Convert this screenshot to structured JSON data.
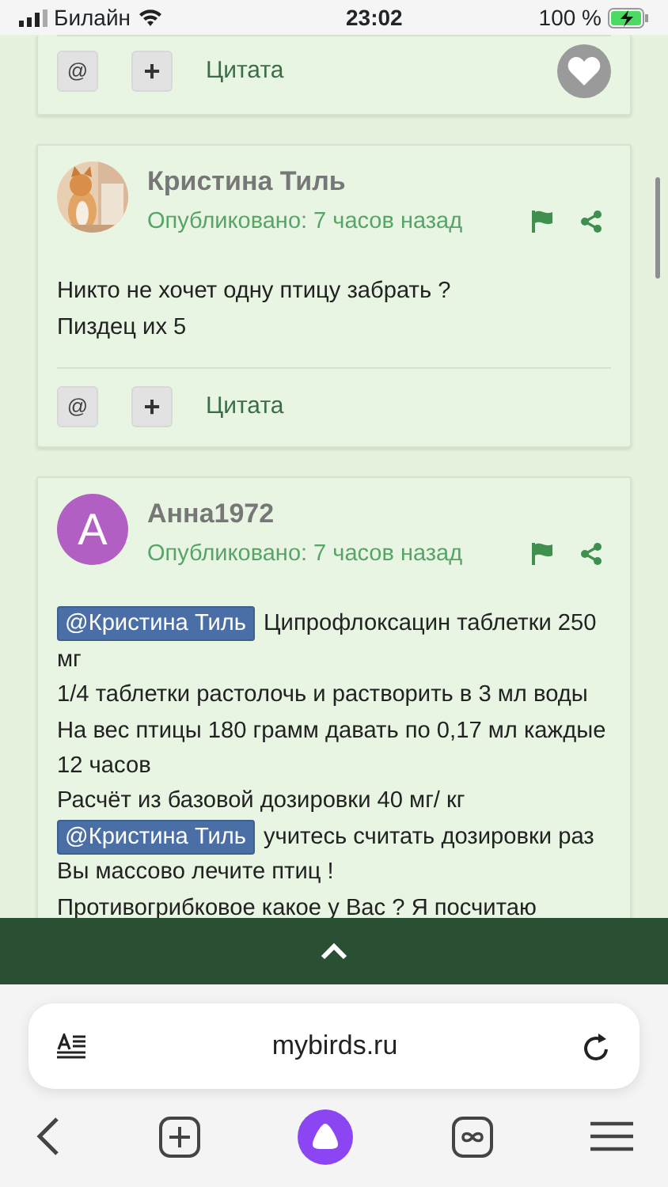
{
  "status_bar": {
    "carrier": "Билайн",
    "time": "23:02",
    "battery": "100 %"
  },
  "posts": [
    {
      "kind": "footer_only",
      "actions": {
        "mention": "@",
        "add": "+",
        "quote": "Цитата"
      },
      "like": true
    },
    {
      "kind": "full",
      "author": "Кристина Тиль",
      "published": "Опубликовано: 7 часов назад",
      "avatar": {
        "kind": "picture"
      },
      "body": [
        [
          {
            "kind": "text",
            "text": "Никто не хочет одну птицу забрать ?"
          }
        ],
        [
          {
            "kind": "text",
            "text": "Пиздец их 5"
          }
        ]
      ],
      "actions": {
        "mention": "@",
        "add": "+",
        "quote": "Цитата"
      }
    },
    {
      "kind": "full",
      "author": "Анна1972",
      "published": "Опубликовано: 7 часов назад",
      "avatar": {
        "kind": "letter",
        "letter": "A",
        "color": "#b25fc4"
      },
      "body": [
        [
          {
            "kind": "mention",
            "text": "@Кристина Тиль"
          },
          {
            "kind": "text",
            "text": "Ципрофлоксацин  таблетки 250 мг"
          }
        ],
        [
          {
            "kind": "text",
            "text": "1/4 таблетки растолочь и растворить в 3 мл воды"
          }
        ],
        [
          {
            "kind": "text",
            "text": "На вес птицы 180 грамм давать по 0,17 мл каждые 12 часов"
          }
        ],
        [
          {
            "kind": "text",
            "text": "Расчёт из базовой дозировки 40 мг/ кг"
          }
        ],
        [
          {
            "kind": "mention",
            "text": "@Кристина Тиль"
          },
          {
            "kind": "text",
            "text": "учитесь считать  дозировки раз"
          }
        ],
        [
          {
            "kind": "text",
            "text": "Вы массово лечите птиц !"
          }
        ],
        [
          {
            "kind": "text",
            "text": "Противогрибковое какое у Вас ? Я посчитаю"
          }
        ]
      ]
    }
  ],
  "browser": {
    "url": "mybirds.ru"
  }
}
